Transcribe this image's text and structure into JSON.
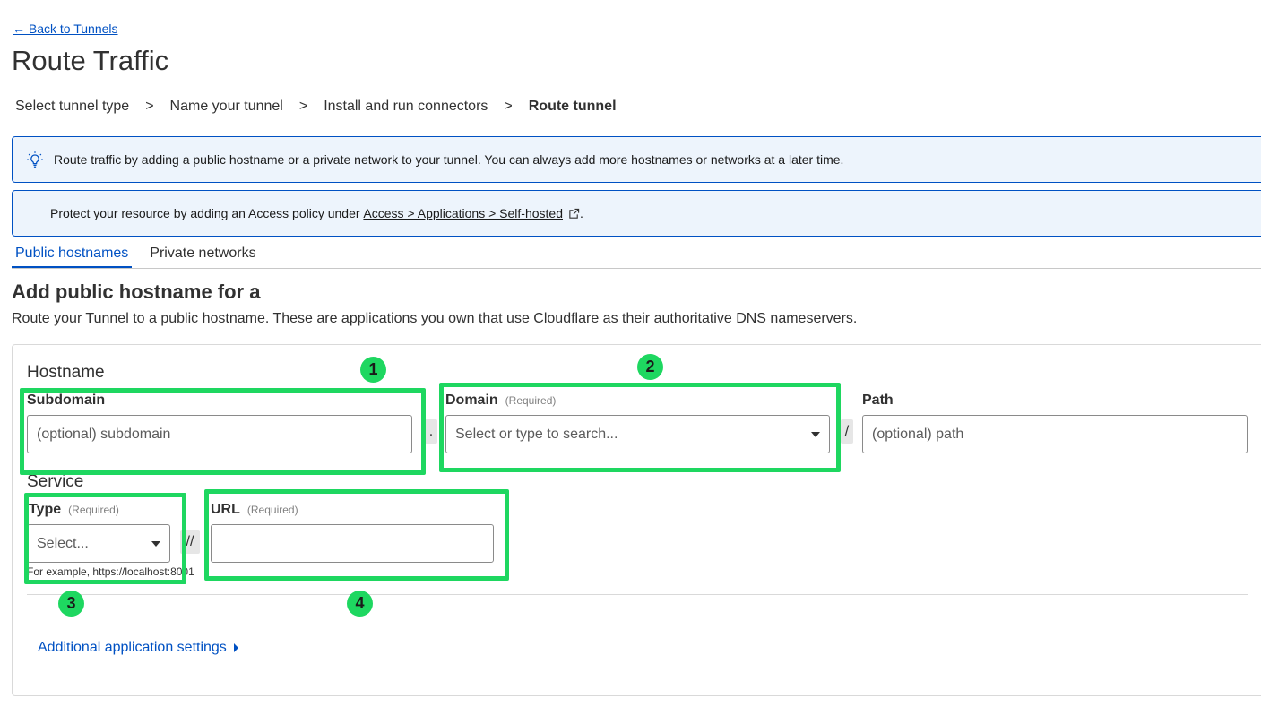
{
  "nav": {
    "back_label": "← Back to Tunnels"
  },
  "page": {
    "title": "Route Traffic"
  },
  "steps": [
    {
      "label": "Select tunnel type"
    },
    {
      "label": "Name your tunnel"
    },
    {
      "label": "Install and run connectors"
    },
    {
      "label": "Route tunnel"
    }
  ],
  "step_separator": ">",
  "banners": {
    "tip": "Route traffic by adding a public hostname or a private network to your tunnel. You can always add more hostnames or networks at a later time.",
    "access_prefix": "Protect your resource by adding an Access policy under ",
    "access_link": "Access > Applications > Self-hosted",
    "access_suffix": "."
  },
  "tabs": [
    {
      "label": "Public hostnames",
      "active": true
    },
    {
      "label": "Private networks",
      "active": false
    }
  ],
  "section": {
    "title": "Add public hostname for a",
    "description": "Route your Tunnel to a public hostname. These are applications you own that use Cloudflare as their authoritative DNS nameservers."
  },
  "hostname": {
    "group_label": "Hostname",
    "subdomain": {
      "label": "Subdomain",
      "placeholder": "(optional) subdomain"
    },
    "dot": ".",
    "domain": {
      "label": "Domain",
      "required": "(Required)",
      "placeholder": "Select or type to search..."
    },
    "slash": "/",
    "path": {
      "label": "Path",
      "placeholder": "(optional) path"
    }
  },
  "service": {
    "group_label": "Service",
    "type": {
      "label": "Type",
      "required": "(Required)",
      "placeholder": "Select..."
    },
    "scheme_sep": "//",
    "url": {
      "label": "URL",
      "required": "(Required)",
      "value": ""
    },
    "hint": "For example, https://localhost:8001"
  },
  "additional_settings": "Additional application settings",
  "annotations": [
    "1",
    "2",
    "3",
    "4"
  ],
  "colors": {
    "accent": "#0051c3",
    "highlight": "#1ed760",
    "banner_bg": "#edf4fc"
  }
}
